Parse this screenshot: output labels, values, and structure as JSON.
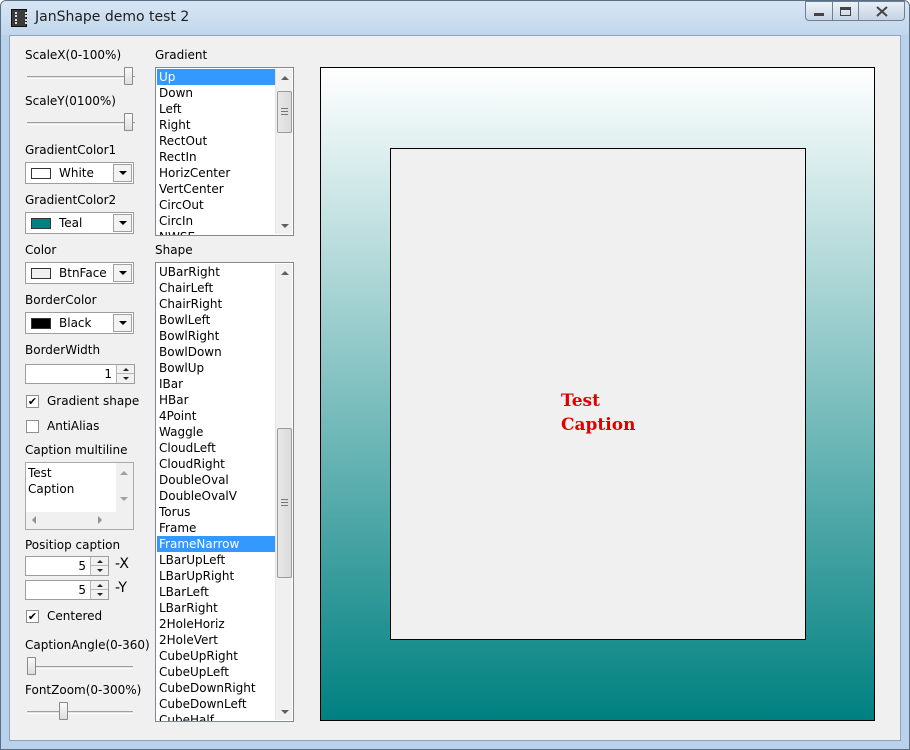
{
  "window": {
    "title": "JanShape demo test 2",
    "controls": [
      "minimize",
      "maximize",
      "close"
    ]
  },
  "left_panel": {
    "scale_x": {
      "label": "ScaleX(0-100%)",
      "value_percent": 100
    },
    "scale_y": {
      "label": "ScaleY(0100%)",
      "value_percent": 100
    },
    "gradient_color1": {
      "label": "GradientColor1",
      "value": "White",
      "swatch": "#ffffff"
    },
    "gradient_color2": {
      "label": "GradientColor2",
      "value": "Teal",
      "swatch": "#008080"
    },
    "color": {
      "label": "Color",
      "value": "BtnFace",
      "swatch": "#f0f0f0"
    },
    "border_color": {
      "label": "BorderColor",
      "value": "Black",
      "swatch": "#000000"
    },
    "border_width": {
      "label": "BorderWidth",
      "value": "1"
    },
    "gradient_shape": {
      "label": "Gradient shape",
      "checked": true
    },
    "anti_alias": {
      "label": "AntiAlias",
      "checked": false
    },
    "caption_multiline": {
      "label": "Caption multiline",
      "lines": [
        "Test",
        "Caption"
      ]
    },
    "position_caption": {
      "label": "Positiop caption",
      "x": {
        "value": "5",
        "suffix": "-X"
      },
      "y": {
        "value": "5",
        "suffix": "-Y"
      }
    },
    "centered": {
      "label": "Centered",
      "checked": true
    },
    "caption_angle": {
      "label": "CaptionAngle(0-360)",
      "value": 0
    },
    "font_zoom": {
      "label": "FontZoom(0-300%)",
      "value_percent": 100
    }
  },
  "gradient_list": {
    "label": "Gradient",
    "items": [
      "Up",
      "Down",
      "Left",
      "Right",
      "RectOut",
      "RectIn",
      "HorizCenter",
      "VertCenter",
      "CircOut",
      "CircIn",
      "NWSE"
    ],
    "selected": "Up"
  },
  "shape_list": {
    "label": "Shape",
    "items": [
      "UBarRight",
      "ChairLeft",
      "ChairRight",
      "BowlLeft",
      "BowlRight",
      "BowlDown",
      "BowlUp",
      "IBar",
      "HBar",
      "4Point",
      "Waggle",
      "CloudLeft",
      "CloudRight",
      "DoubleOval",
      "DoubleOvalV",
      "Torus",
      "Frame",
      "FrameNarrow",
      "LBarUpLeft",
      "LBarUpRight",
      "LBarLeft",
      "LBarRight",
      "2HoleHoriz",
      "2HoleVert",
      "CubeUpRight",
      "CubeUpLeft",
      "CubeDownRight",
      "CubeDownLeft",
      "CubeHalf"
    ],
    "selected": "FrameNarrow"
  },
  "preview": {
    "caption_lines": [
      "Test",
      "Caption"
    ],
    "gradient_top": "#ffffff",
    "gradient_bottom": "#008080",
    "caption_color": "#e00000",
    "inner_fill": "#f0f0f0"
  }
}
